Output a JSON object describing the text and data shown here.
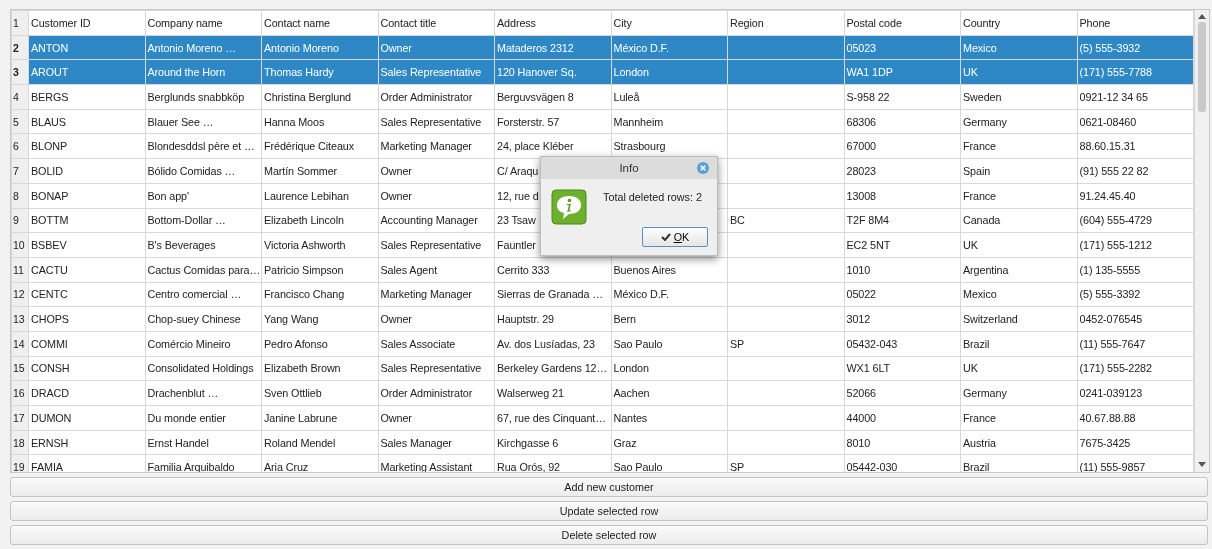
{
  "table": {
    "header_row_number": "1",
    "columns": [
      "Customer ID",
      "Company name",
      "Contact name",
      "Contact title",
      "Address",
      "City",
      "Region",
      "Postal code",
      "Country",
      "Phone"
    ],
    "rows": [
      {
        "number": "2",
        "selected": true,
        "cells": [
          "ANTON",
          "Antonio Moreno …",
          "Antonio Moreno",
          "Owner",
          "Mataderos  2312",
          "México D.F.",
          null,
          "05023",
          "Mexico",
          "(5) 555-3932"
        ]
      },
      {
        "number": "3",
        "selected": true,
        "cells": [
          "AROUT",
          "Around the Horn",
          "Thomas Hardy",
          "Sales Representative",
          "120 Hanover Sq.",
          "London",
          null,
          "WA1 1DP",
          "UK",
          "(171) 555-7788"
        ]
      },
      {
        "number": "4",
        "selected": false,
        "cells": [
          "BERGS",
          "Berglunds snabbköp",
          "Christina Berglund",
          "Order Administrator",
          "Berguvsvägen  8",
          "Luleå",
          null,
          "S-958 22",
          "Sweden",
          "0921-12 34 65"
        ]
      },
      {
        "number": "5",
        "selected": false,
        "cells": [
          "BLAUS",
          "Blauer See …",
          "Hanna Moos",
          "Sales Representative",
          "Forsterstr. 57",
          "Mannheim",
          null,
          "68306",
          "Germany",
          "0621-08460"
        ]
      },
      {
        "number": "6",
        "selected": false,
        "cells": [
          "BLONP",
          "Blondesddsl père et …",
          "Frédérique Citeaux",
          "Marketing Manager",
          "24, place Kléber",
          "Strasbourg",
          null,
          "67000",
          "France",
          "88.60.15.31"
        ]
      },
      {
        "number": "7",
        "selected": false,
        "cells": [
          "BOLID",
          "Bólido Comidas …",
          "Martín Sommer",
          "Owner",
          "C/ Araqu",
          null,
          null,
          "28023",
          "Spain",
          "(91) 555 22 82"
        ]
      },
      {
        "number": "8",
        "selected": false,
        "cells": [
          "BONAP",
          "Bon app'",
          "Laurence Lebihan",
          "Owner",
          "12, rue d",
          null,
          null,
          "13008",
          "France",
          "91.24.45.40"
        ]
      },
      {
        "number": "9",
        "selected": false,
        "cells": [
          "BOTTM",
          "Bottom-Dollar …",
          "Elizabeth Lincoln",
          "Accounting Manager",
          "23 Tsaw",
          null,
          "BC",
          "T2F 8M4",
          "Canada",
          "(604) 555-4729"
        ]
      },
      {
        "number": "10",
        "selected": false,
        "cells": [
          "BSBEV",
          "B's Beverages",
          "Victoria Ashworth",
          "Sales Representative",
          "Fauntler",
          null,
          null,
          "EC2 5NT",
          "UK",
          "(171) 555-1212"
        ]
      },
      {
        "number": "11",
        "selected": false,
        "cells": [
          "CACTU",
          "Cactus Comidas para…",
          "Patricio Simpson",
          "Sales Agent",
          "Cerrito 333",
          "Buenos Aires",
          null,
          "1010",
          "Argentina",
          "(1) 135-5555"
        ]
      },
      {
        "number": "12",
        "selected": false,
        "cells": [
          "CENTC",
          "Centro comercial …",
          "Francisco Chang",
          "Marketing Manager",
          "Sierras de Granada …",
          "México D.F.",
          null,
          "05022",
          "Mexico",
          "(5) 555-3392"
        ]
      },
      {
        "number": "13",
        "selected": false,
        "cells": [
          "CHOPS",
          "Chop-suey Chinese",
          "Yang Wang",
          "Owner",
          "Hauptstr. 29",
          "Bern",
          null,
          "3012",
          "Switzerland",
          "0452-076545"
        ]
      },
      {
        "number": "14",
        "selected": false,
        "cells": [
          "COMMI",
          "Comércio Mineiro",
          "Pedro Afonso",
          "Sales Associate",
          "Av. dos Lusíadas, 23",
          "Sao Paulo",
          "SP",
          "05432-043",
          "Brazil",
          "(11) 555-7647"
        ]
      },
      {
        "number": "15",
        "selected": false,
        "cells": [
          "CONSH",
          "Consolidated Holdings",
          "Elizabeth Brown",
          "Sales Representative",
          "Berkeley Gardens 12…",
          "London",
          null,
          "WX1 6LT",
          "UK",
          "(171) 555-2282"
        ]
      },
      {
        "number": "16",
        "selected": false,
        "cells": [
          "DRACD",
          "Drachenblut …",
          "Sven Ottlieb",
          "Order Administrator",
          "Walserweg 21",
          "Aachen",
          null,
          "52066",
          "Germany",
          "0241-039123"
        ]
      },
      {
        "number": "17",
        "selected": false,
        "cells": [
          "DUMON",
          "Du monde entier",
          "Janine Labrune",
          "Owner",
          "67, rue des Cinquant…",
          "Nantes",
          null,
          "44000",
          "France",
          "40.67.88.88"
        ]
      },
      {
        "number": "18",
        "selected": false,
        "cells": [
          "ERNSH",
          "Ernst Handel",
          "Roland Mendel",
          "Sales Manager",
          "Kirchgasse 6",
          "Graz",
          null,
          "8010",
          "Austria",
          "7675-3425"
        ]
      },
      {
        "number": "19",
        "selected": false,
        "cells": [
          "FAMIA",
          "Familia Arquibaldo",
          "Aria Cruz",
          "Marketing Assistant",
          "Rua Orós, 92",
          "Sao Paulo",
          "SP",
          "05442-030",
          "Brazil",
          "(11) 555-9857"
        ]
      }
    ]
  },
  "dialog": {
    "title": "Info",
    "message": "Total deleted rows: 2",
    "button": "OK"
  },
  "buttons": [
    "Add new customer",
    "Update selected row",
    "Delete selected row"
  ]
}
